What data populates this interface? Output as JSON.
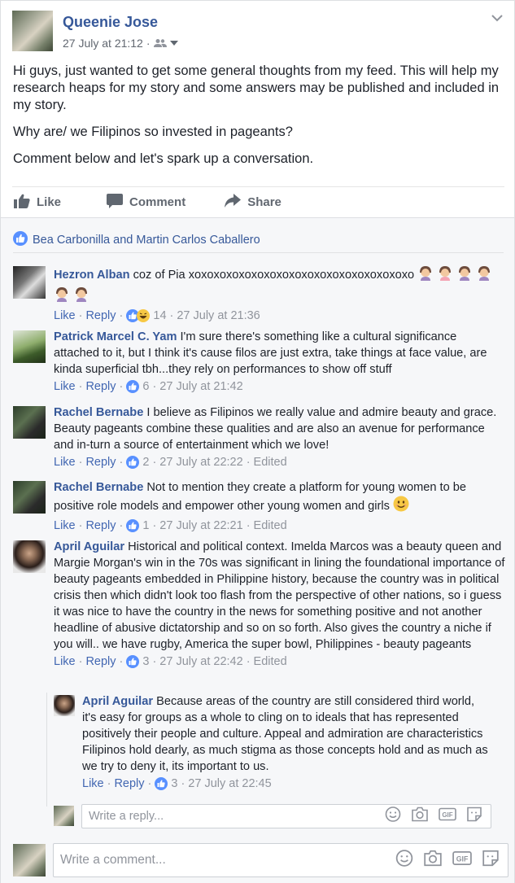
{
  "post": {
    "author": "Queenie Jose",
    "timestamp": "27 July at 21:12",
    "audience_icon": "friends-icon",
    "paragraphs": [
      "Hi guys, just wanted to get some general thoughts from my feed. This will help my research heaps for my story and some answers may be published and included in my story.",
      "Why are/ we Filipinos so invested in pageants?",
      "Comment below and let's spark up a conversation."
    ]
  },
  "actions": {
    "like": "Like",
    "comment": "Comment",
    "share": "Share"
  },
  "likers": "Bea Carbonilla and Martin Carlos Caballero",
  "comment_actions": {
    "like": "Like",
    "reply": "Reply"
  },
  "comments": [
    {
      "name": "Hezron Alban",
      "text": "coz of Pia xoxoxoxoxoxoxoxoxoxoxoxoxoxoxoxoxoxo",
      "reactions": "14",
      "time": "27 July at 21:36",
      "edited": ""
    },
    {
      "name": "Patrick Marcel C. Yam",
      "text": "I'm sure there's something like a cultural significance attached to it, but I think it's cause filos are just extra, take things at face value, are kinda superficial tbh...they rely on performances to show off stuff",
      "reactions": "6",
      "time": "27 July at 21:42",
      "edited": ""
    },
    {
      "name": "Rachel Bernabe",
      "text": "I believe as Filipinos we really value and admire beauty and grace. Beauty pageants combine these qualities and are also an avenue for performance and in-turn a source of entertainment which we love!",
      "reactions": "2",
      "time": "27 July at 22:22",
      "edited": "Edited"
    },
    {
      "name": "Rachel Bernabe",
      "text": "Not to mention they create a platform for young women to be positive role models and empower other young women and girls",
      "reactions": "1",
      "time": "27 July at 22:21",
      "edited": "Edited"
    },
    {
      "name": "April Aguilar",
      "text": "Historical and political context. Imelda Marcos was a beauty queen and Margie Morgan's win in the 70s was significant in lining the foundational importance of beauty pageants embedded in Philippine history, because the country was in political crisis then which didn't look too flash from the perspective of other nations, so i guess it was nice to have the country in the news for something positive and not another headline of abusive dictatorship and so on so forth. Also gives the country a niche if you will.. we have rugby, America the super bowl, Philippines - beauty pageants",
      "reactions": "3",
      "time": "27 July at 22:42",
      "edited": "Edited"
    }
  ],
  "reply": {
    "name": "April Aguilar",
    "text": "Because areas of the country are still considered third world, it's easy for groups as a whole to cling on to ideals that has represented positively their people and culture. Appeal and admiration are characteristics Filipinos hold dearly, as much stigma as those concepts hold and as much as we try to deny it, its important to us.",
    "reactions": "3",
    "time": "27 July at 22:45"
  },
  "reply_input": {
    "placeholder": "Write a reply..."
  },
  "comment_input": {
    "placeholder": "Write a comment..."
  },
  "input_icons": [
    "emoji-icon",
    "camera-icon",
    "gif-icon",
    "sticker-icon"
  ],
  "colors": {
    "link": "#365899",
    "action_link": "#4267b2",
    "muted": "#90949c",
    "like_blue": "#5890ff"
  }
}
